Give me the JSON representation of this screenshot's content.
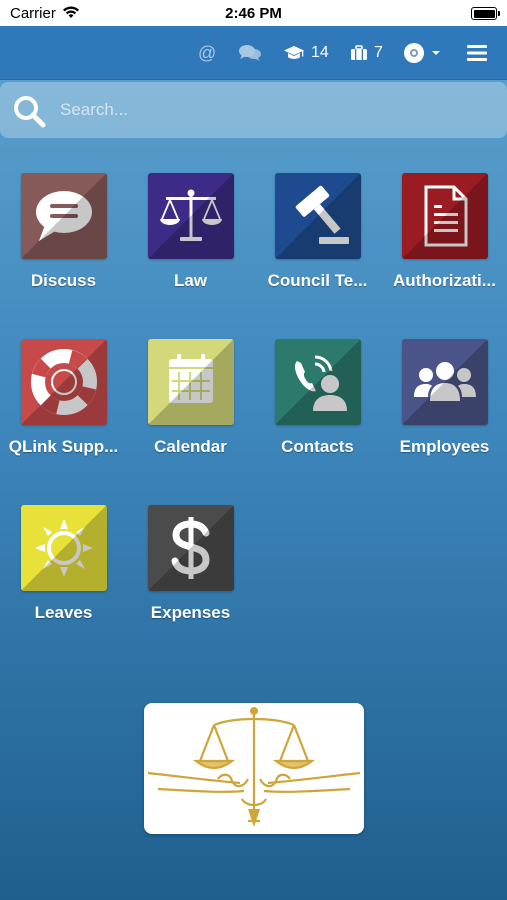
{
  "status_bar": {
    "carrier": "Carrier",
    "time": "2:46 PM"
  },
  "nav": {
    "at_symbol": "@",
    "courses_count": "14",
    "tasks_count": "7",
    "icons": [
      "at-icon",
      "chat-icon",
      "graduation-cap-icon",
      "briefcase-icon",
      "avatar-icon",
      "hamburger-menu-icon"
    ]
  },
  "search": {
    "placeholder": "Search..."
  },
  "apps": [
    {
      "label": "Discuss",
      "icon": "chat-bubble-icon",
      "color": "#875a5a"
    },
    {
      "label": "Law",
      "icon": "scales-icon",
      "color": "#3d2b87"
    },
    {
      "label": "Council Te...",
      "icon": "gavel-icon",
      "color": "#1e4b8f"
    },
    {
      "label": "Authorizati...",
      "icon": "document-icon",
      "color": "#9b1b22"
    },
    {
      "label": "QLink Supp...",
      "icon": "lifebuoy-icon",
      "color": "#c74a4a"
    },
    {
      "label": "Calendar",
      "icon": "calendar-icon",
      "color": "#d3d97a"
    },
    {
      "label": "Contacts",
      "icon": "contact-phone-icon",
      "color": "#2c7a6c"
    },
    {
      "label": "Employees",
      "icon": "people-icon",
      "color": "#4a5488"
    },
    {
      "label": "Leaves",
      "icon": "sun-icon",
      "color": "#e7e13a"
    },
    {
      "label": "Expenses",
      "icon": "dollar-icon",
      "color": "#4b4b4b"
    }
  ],
  "logo": {
    "name": "scales-of-justice-logo"
  }
}
